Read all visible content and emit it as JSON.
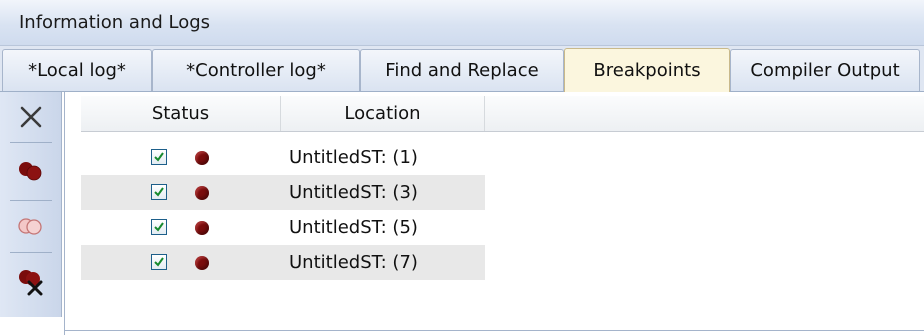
{
  "panel": {
    "title": "Information and Logs"
  },
  "tabs": [
    {
      "label": "*Local log*",
      "active": false
    },
    {
      "label": "*Controller log*",
      "active": false
    },
    {
      "label": "Find and Replace",
      "active": false
    },
    {
      "label": "Breakpoints",
      "active": true
    },
    {
      "label": "Compiler Output",
      "active": false
    }
  ],
  "toolbar": {
    "buttons": [
      {
        "icon": "close-x-icon"
      },
      {
        "icon": "enable-all-breakpoints-icon"
      },
      {
        "icon": "disable-all-breakpoints-icon"
      },
      {
        "icon": "delete-all-breakpoints-icon"
      }
    ]
  },
  "breakpoints": {
    "columns": [
      "Status",
      "Location"
    ],
    "rows": [
      {
        "enabled": true,
        "location": "UntitledST: (1)"
      },
      {
        "enabled": true,
        "location": "UntitledST: (3)"
      },
      {
        "enabled": true,
        "location": "UntitledST: (5)"
      },
      {
        "enabled": true,
        "location": "UntitledST: (7)"
      }
    ]
  },
  "colors": {
    "breakpoint": "#7a0c0c",
    "active_tab": "#fbf6de",
    "row_alt": "#e8e8e8"
  }
}
